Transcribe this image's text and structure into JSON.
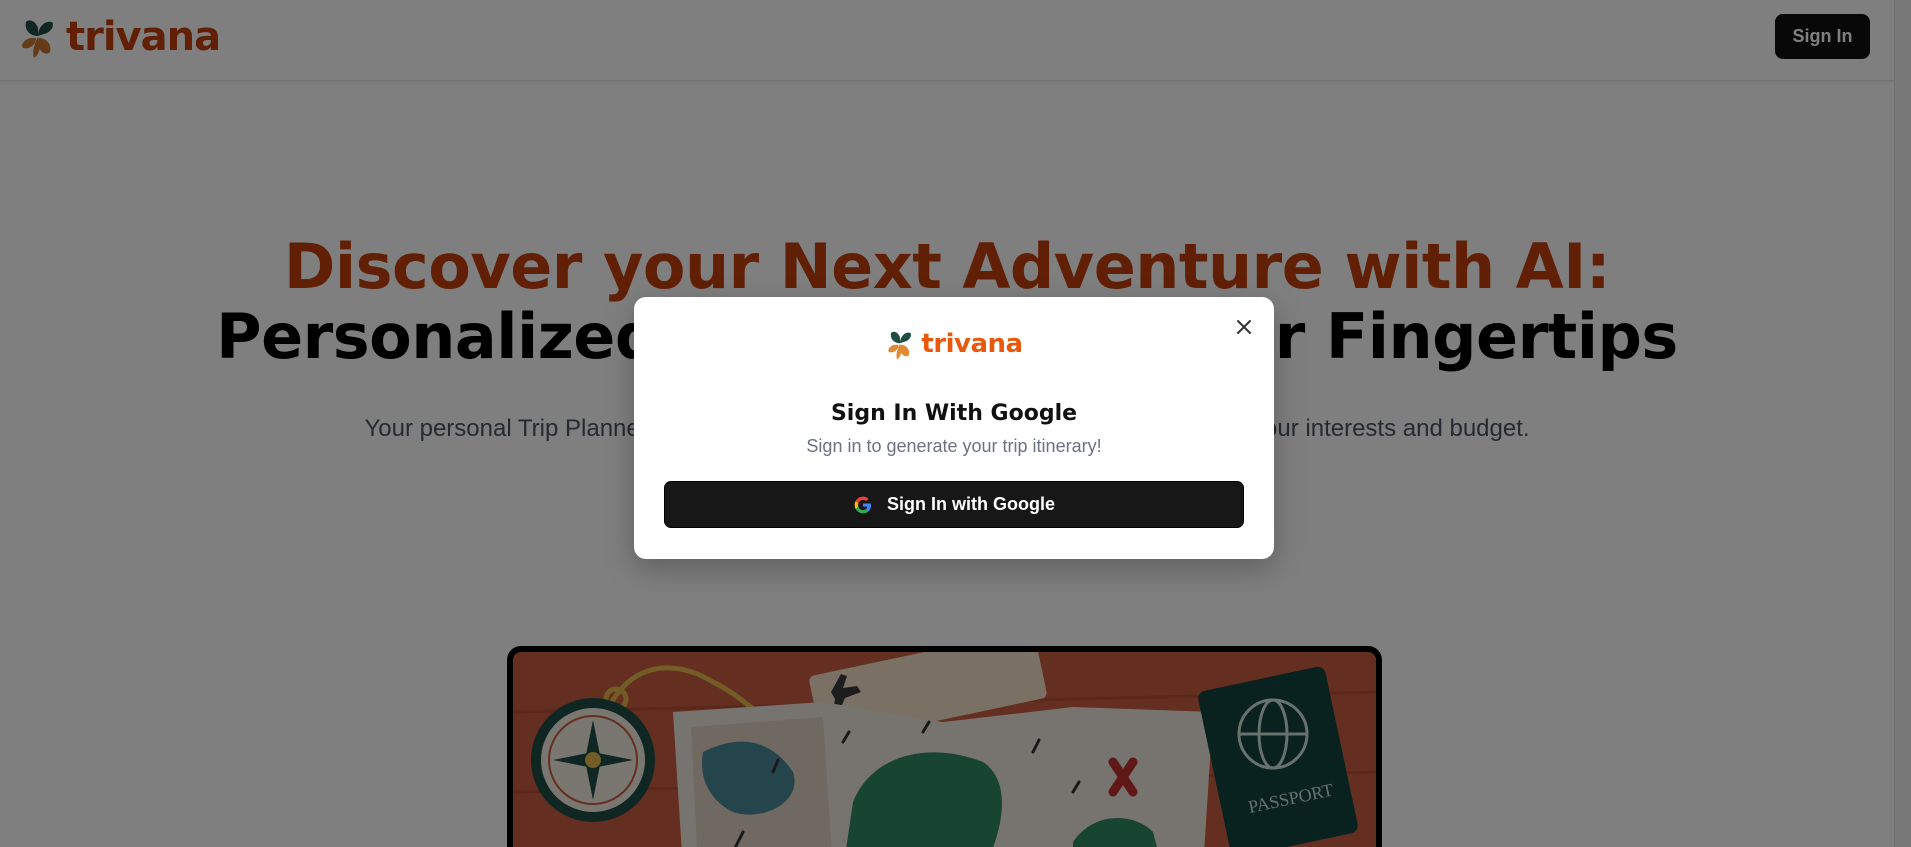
{
  "header": {
    "brand_name": "trivana",
    "signin_label": "Sign In"
  },
  "hero": {
    "title_line1": "Discover your Next Adventure with AI:",
    "title_line2": "Personalized Itineraries at Your Fingertips",
    "subtitle": "Your personal Trip Planner and travel curator, creating custom itineraries tailored to your interests and budget."
  },
  "illustration": {
    "passport_text": "PASSPORT"
  },
  "modal": {
    "brand_name": "trivana",
    "title": "Sign In With Google",
    "subtitle": "Sign in to generate your trip itinerary!",
    "google_button_label": "Sign In with Google",
    "close_icon": "close-icon"
  },
  "colors": {
    "brand_orange": "#c2410c",
    "modal_brand_orange": "#ea580c",
    "button_dark": "#171717",
    "logo_green": "#1f4d44",
    "logo_orange": "#c7782f"
  }
}
